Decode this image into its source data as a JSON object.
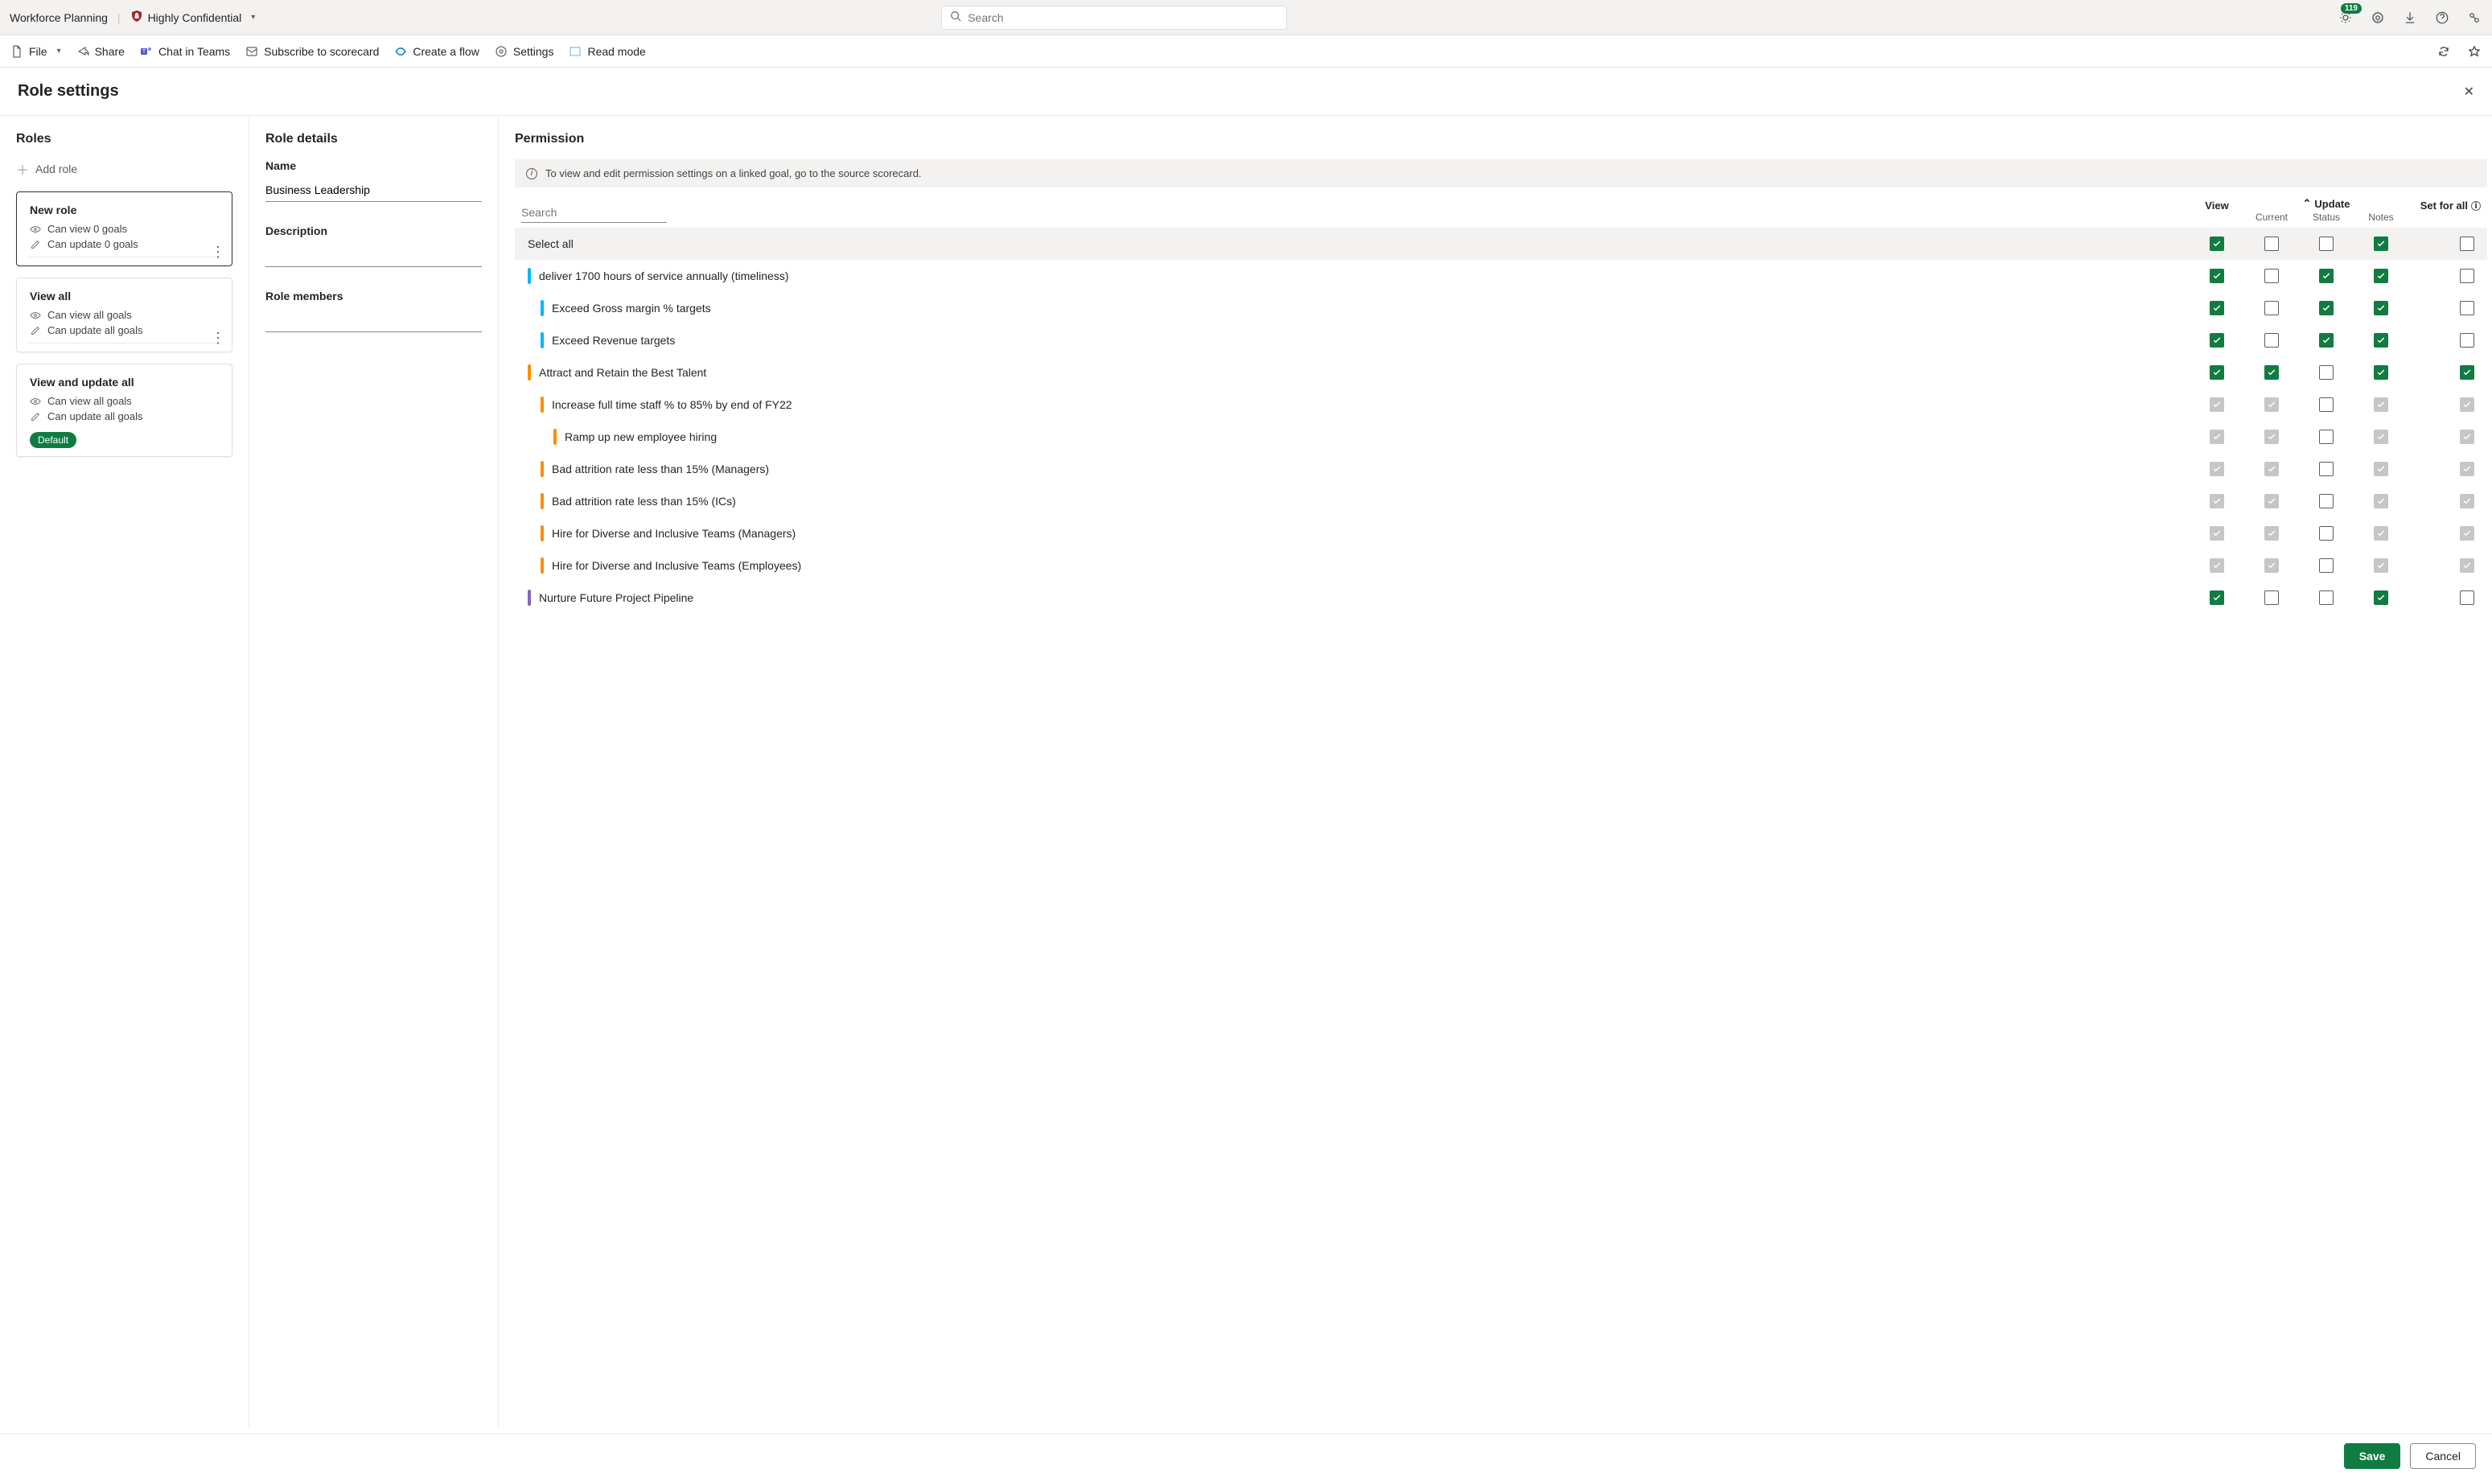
{
  "topbar": {
    "title": "Workforce Planning",
    "sensitivity": "Highly Confidential",
    "search_placeholder": "Search",
    "notification_count": "119"
  },
  "cmdbar": {
    "file": "File",
    "share": "Share",
    "chat": "Chat in Teams",
    "subscribe": "Subscribe to scorecard",
    "flow": "Create a flow",
    "settings": "Settings",
    "readmode": "Read mode"
  },
  "page": {
    "title": "Role settings"
  },
  "roles": {
    "section": "Roles",
    "add": "Add role",
    "cards": [
      {
        "name": "New role",
        "view_text": "Can view 0 goals",
        "update_text": "Can update 0 goals",
        "selected": true,
        "show_more": true
      },
      {
        "name": "View all",
        "view_text": "Can view all goals",
        "update_text": "Can update all goals",
        "selected": false,
        "show_more": true
      },
      {
        "name": "View and update all",
        "view_text": "Can view all goals",
        "update_text": "Can update all goals",
        "selected": false,
        "default": true
      }
    ],
    "default_label": "Default"
  },
  "details": {
    "section": "Role details",
    "name_label": "Name",
    "name_value": "Business Leadership",
    "desc_label": "Description",
    "desc_value": "",
    "members_label": "Role members",
    "members_value": ""
  },
  "perm": {
    "section": "Permission",
    "banner": "To view and edit permission settings on a linked goal, go to the source scorecard.",
    "search_placeholder": "Search",
    "col_view": "View",
    "col_update": "Update",
    "col_current": "Current",
    "col_status": "Status",
    "col_notes": "Notes",
    "col_setall": "Set for all",
    "select_all": "Select all",
    "goals": [
      {
        "label": "Select all",
        "indent": 0,
        "bar": "",
        "checks": [
          "checked",
          "",
          "",
          "checked",
          ""
        ],
        "select_all": true
      },
      {
        "label": "deliver 1700 hours of service annually (timeliness)",
        "indent": 0,
        "bar": "cyan",
        "checks": [
          "checked",
          "",
          "checked",
          "checked",
          ""
        ]
      },
      {
        "label": "Exceed Gross margin % targets",
        "indent": 1,
        "bar": "cyan",
        "checks": [
          "checked",
          "",
          "checked",
          "checked",
          ""
        ]
      },
      {
        "label": "Exceed Revenue targets",
        "indent": 1,
        "bar": "cyan",
        "checks": [
          "checked",
          "",
          "checked",
          "checked",
          ""
        ]
      },
      {
        "label": "Attract and Retain the Best Talent",
        "indent": 0,
        "bar": "orange",
        "checks": [
          "checked",
          "checked",
          "",
          "checked",
          "checked"
        ]
      },
      {
        "label": "Increase full time staff % to 85% by end of FY22",
        "indent": 1,
        "bar": "orange",
        "checks": [
          "disabled",
          "disabled",
          "",
          "disabled",
          "disabled"
        ]
      },
      {
        "label": "Ramp up new employee hiring",
        "indent": 2,
        "bar": "orange",
        "checks": [
          "disabled",
          "disabled",
          "",
          "disabled",
          "disabled"
        ]
      },
      {
        "label": "Bad attrition rate less than 15% (Managers)",
        "indent": 1,
        "bar": "orange",
        "checks": [
          "disabled",
          "disabled",
          "",
          "disabled",
          "disabled"
        ]
      },
      {
        "label": "Bad attrition rate less than 15% (ICs)",
        "indent": 1,
        "bar": "orange",
        "checks": [
          "disabled",
          "disabled",
          "",
          "disabled",
          "disabled"
        ]
      },
      {
        "label": "Hire for Diverse and Inclusive Teams (Managers)",
        "indent": 1,
        "bar": "orange",
        "checks": [
          "disabled",
          "disabled",
          "",
          "disabled",
          "disabled"
        ]
      },
      {
        "label": "Hire for Diverse and Inclusive Teams (Employees)",
        "indent": 1,
        "bar": "orange",
        "checks": [
          "disabled",
          "disabled",
          "",
          "disabled",
          "disabled"
        ]
      },
      {
        "label": "Nurture Future Project Pipeline",
        "indent": 0,
        "bar": "purple",
        "checks": [
          "checked",
          "",
          "",
          "checked",
          ""
        ]
      }
    ]
  },
  "footer": {
    "save": "Save",
    "cancel": "Cancel"
  }
}
